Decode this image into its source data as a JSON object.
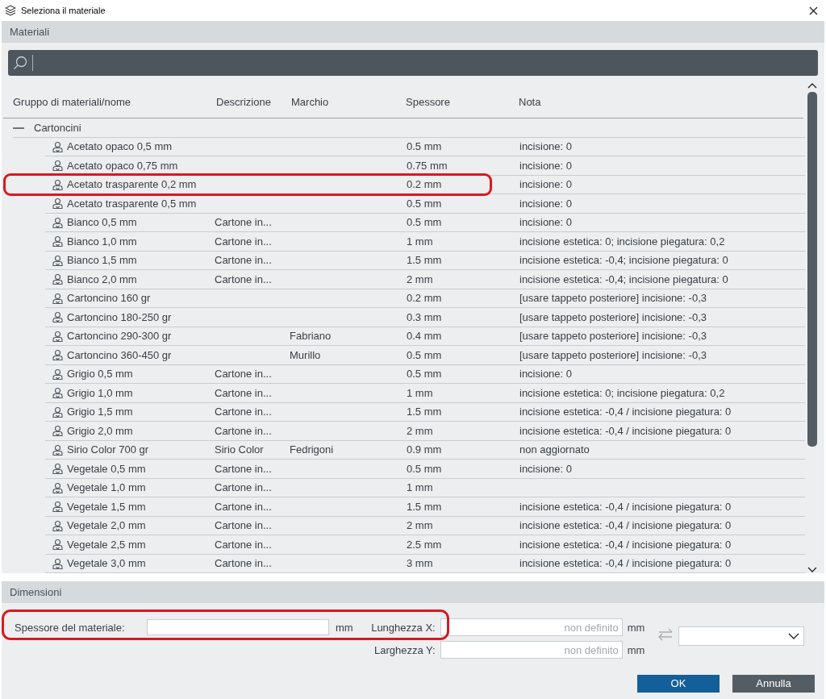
{
  "window": {
    "title": "Seleziona il materiale"
  },
  "materials_section": {
    "title": "Materiali"
  },
  "search": {
    "cursor": true
  },
  "table": {
    "columns": [
      "Gruppo di materiali/nome",
      "Descrizione",
      "Marchio",
      "Spessore",
      "Nota"
    ],
    "groups": [
      {
        "name": "Cartoncini",
        "expanded": true,
        "rows": [
          {
            "cells": [
              "Acetato opaco 0,5 mm",
              "",
              "",
              "0.5 mm",
              "incisione: 0"
            ],
            "annotated": false
          },
          {
            "cells": [
              "Acetato opaco 0,75 mm",
              "",
              "",
              "0.75 mm",
              "incisione: 0"
            ],
            "annotated": false
          },
          {
            "cells": [
              "Acetato trasparente 0,2 mm",
              "",
              "",
              "0.2 mm",
              "incisione: 0"
            ],
            "annotated": true
          },
          {
            "cells": [
              "Acetato trasparente 0,5 mm",
              "",
              "",
              "0.5 mm",
              "incisione: 0"
            ],
            "annotated": false
          },
          {
            "cells": [
              "Bianco 0,5 mm",
              "Cartone in...",
              "",
              "0.5 mm",
              "incisione: 0"
            ],
            "annotated": false
          },
          {
            "cells": [
              "Bianco 1,0 mm",
              "Cartone in...",
              "",
              "1 mm",
              "incisione estetica: 0; incisione piegatura: 0,2"
            ],
            "annotated": false
          },
          {
            "cells": [
              "Bianco 1,5 mm",
              "Cartone in...",
              "",
              "1.5 mm",
              "incisione estetica: -0,4; incisione piegatura: 0"
            ],
            "annotated": false
          },
          {
            "cells": [
              "Bianco 2,0 mm",
              "Cartone in...",
              "",
              "2 mm",
              "incisione estetica: -0,4; incisione piegatura: 0"
            ],
            "annotated": false
          },
          {
            "cells": [
              "Cartoncino 160 gr",
              "",
              "",
              "0.2 mm",
              "[usare tappeto posteriore] incisione: -0,3"
            ],
            "annotated": false
          },
          {
            "cells": [
              "Cartoncino 180-250 gr",
              "",
              "",
              "0.3 mm",
              "[usare tappeto posteriore] incisione: -0,3"
            ],
            "annotated": false
          },
          {
            "cells": [
              "Cartoncino 290-300 gr",
              "",
              "Fabriano",
              "0.4 mm",
              "[usare tappeto posteriore] incisione: -0,3"
            ],
            "annotated": false
          },
          {
            "cells": [
              "Cartoncino 360-450 gr",
              "",
              "Murillo",
              "0.5 mm",
              "[usare tappeto posteriore] incisione: -0,3"
            ],
            "annotated": false
          },
          {
            "cells": [
              "Grigio 0,5 mm",
              "Cartone in...",
              "",
              "0.5 mm",
              "incisione: 0"
            ],
            "annotated": false
          },
          {
            "cells": [
              "Grigio 1,0 mm",
              "Cartone in...",
              "",
              "1  mm",
              "incisione estetica: 0; incisione piegatura: 0,2"
            ],
            "annotated": false
          },
          {
            "cells": [
              "Grigio 1,5 mm",
              "Cartone in...",
              "",
              "1.5 mm",
              "incisione estetica: -0,4 / incisione piegatura: 0"
            ],
            "annotated": false
          },
          {
            "cells": [
              "Grigio 2,0 mm",
              "Cartone in...",
              "",
              "2 mm",
              "incisione estetica: -0,4 / incisione piegatura: 0"
            ],
            "annotated": false
          },
          {
            "cells": [
              "Sirio Color 700 gr",
              "Sirio Color",
              "Fedrigoni",
              "0.9 mm",
              "non aggiornato"
            ],
            "annotated": false
          },
          {
            "cells": [
              "Vegetale 0,5 mm",
              "Cartone in...",
              "",
              "0.5 mm",
              "incisione: 0"
            ],
            "annotated": false
          },
          {
            "cells": [
              "Vegetale 1,0 mm",
              "Cartone in...",
              "",
              "1 mm",
              ""
            ],
            "annotated": false
          },
          {
            "cells": [
              "Vegetale 1,5 mm",
              "Cartone in...",
              "",
              "1.5 mm",
              "incisione estetica: -0,4 / incisione piegatura: 0"
            ],
            "annotated": false
          },
          {
            "cells": [
              "Vegetale 2,0 mm",
              "Cartone in...",
              "",
              "2 mm",
              "incisione estetica: -0,4 / incisione piegatura: 0"
            ],
            "annotated": false
          },
          {
            "cells": [
              "Vegetale 2,5 mm",
              "Cartone in...",
              "",
              "2.5 mm",
              "incisione estetica: -0,4 / incisione piegatura: 0"
            ],
            "annotated": false
          },
          {
            "cells": [
              "Vegetale 3,0 mm",
              "Cartone in...",
              "",
              "3  mm",
              "incisione estetica: -0,4 / incisione piegatura: 0"
            ],
            "annotated": false
          }
        ]
      }
    ]
  },
  "dimensions_section": {
    "title": "Dimensioni",
    "thickness": {
      "label": "Spessore del materiale:",
      "unit": "mm",
      "annotated": true
    },
    "length_x": {
      "label": "Lunghezza X:",
      "placeholder": "non definito",
      "unit": "mm"
    },
    "width_y": {
      "label": "Larghezza Y:",
      "placeholder": "non definito",
      "unit": "mm"
    },
    "dropdown": {
      "expanded": false
    }
  },
  "buttons": [
    {
      "label": "OK",
      "kind": "primary"
    },
    {
      "label": "Annulla",
      "kind": "secondary"
    }
  ]
}
